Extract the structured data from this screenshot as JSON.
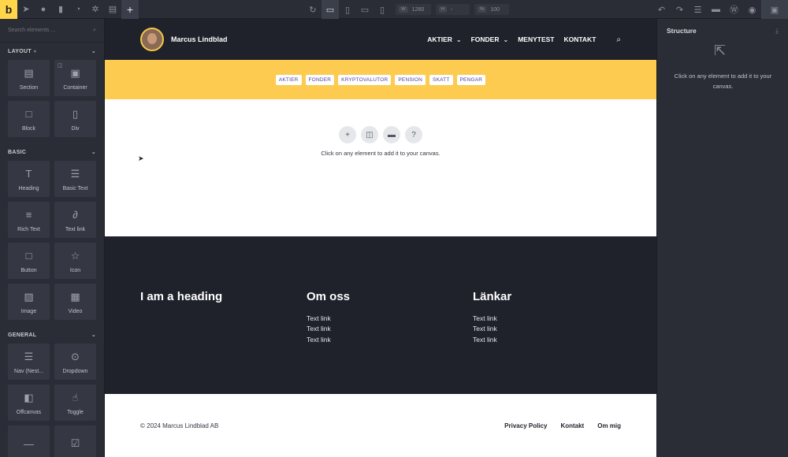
{
  "toolbar": {
    "logo": "b",
    "left_icons": [
      "pointer-icon",
      "help-icon",
      "pages-icon",
      "history-icon",
      "settings-icon",
      "template-icon"
    ],
    "add": "+",
    "width_label": "W",
    "width_value": "1260",
    "height_label": "H",
    "height_value": "-",
    "zoom_label": "%",
    "zoom_value": "100"
  },
  "left_panel": {
    "search_placeholder": "Search elements ...",
    "sections": [
      {
        "title": "LAYOUT",
        "items": [
          {
            "label": "Section",
            "icon": "section-icon"
          },
          {
            "label": "Container",
            "icon": "container-icon"
          },
          {
            "label": "Block",
            "icon": "block-icon"
          },
          {
            "label": "Div",
            "icon": "div-icon"
          }
        ]
      },
      {
        "title": "BASIC",
        "items": [
          {
            "label": "Heading",
            "icon": "heading-icon"
          },
          {
            "label": "Basic Text",
            "icon": "text-icon"
          },
          {
            "label": "Rich Text",
            "icon": "rich-text-icon"
          },
          {
            "label": "Text link",
            "icon": "link-icon"
          },
          {
            "label": "Button",
            "icon": "button-icon"
          },
          {
            "label": "Icon",
            "icon": "star-icon"
          },
          {
            "label": "Image",
            "icon": "image-icon"
          },
          {
            "label": "Video",
            "icon": "video-icon"
          }
        ]
      },
      {
        "title": "GENERAL",
        "items": [
          {
            "label": "Nav (Nest...",
            "icon": "nav-icon"
          },
          {
            "label": "Dropdown",
            "icon": "dropdown-icon"
          },
          {
            "label": "Offcanvas",
            "icon": "offcanvas-icon"
          },
          {
            "label": "Toggle",
            "icon": "toggle-icon"
          }
        ]
      }
    ]
  },
  "site": {
    "brand": "Marcus Lindblad",
    "nav": [
      {
        "label": "AKTIER",
        "dropdown": true
      },
      {
        "label": "FONDER",
        "dropdown": true
      },
      {
        "label": "MENYTEST",
        "dropdown": false
      },
      {
        "label": "KONTAKT",
        "dropdown": false
      }
    ],
    "tags": [
      "AKTIER",
      "FONDER",
      "KRYPTOVALUTOR",
      "PENSION",
      "SKATT",
      "PENGAR"
    ],
    "empty_message": "Click on any element to add it to your canvas.",
    "footer_columns": [
      {
        "heading": "I am a heading",
        "links": []
      },
      {
        "heading": "Om oss",
        "links": [
          "Text link",
          "Text link",
          "Text link"
        ]
      },
      {
        "heading": "Länkar",
        "links": [
          "Text link",
          "Text link",
          "Text link"
        ]
      }
    ],
    "copyright": "© 2024 Marcus Lindblad AB",
    "bottom_links": [
      "Privacy Policy",
      "Kontakt",
      "Om mig"
    ]
  },
  "structure_panel": {
    "title": "Structure",
    "message": "Click on any element to add it to your canvas."
  },
  "colors": {
    "accent": "#ffd64a",
    "header_bg": "#1f212b",
    "tag_bar": "#fccb50",
    "tag_text": "#4a3fa3"
  }
}
